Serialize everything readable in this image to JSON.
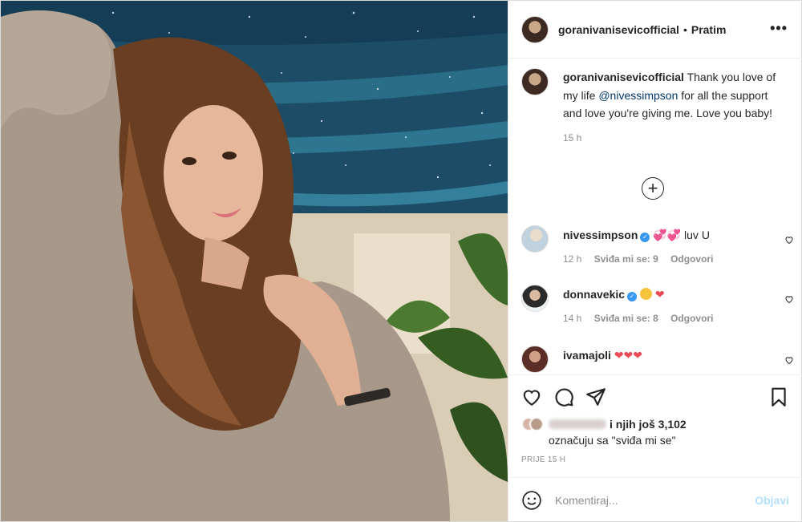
{
  "post": {
    "username": "goranivanisevicofficial",
    "separator": "•",
    "follow_status": "Pratim",
    "more_label": "•••",
    "caption": {
      "username": "goranivanisevicofficial",
      "text_before": " Thank you love of my life ",
      "mention": "@nivessimpson",
      "text_after": " for all the support and love you're giving me. Love you baby!",
      "time": "15 h"
    },
    "load_more_label": "+"
  },
  "comments": [
    {
      "username": "nivessimpson",
      "verified": true,
      "text": " luv U",
      "time": "12 h",
      "likes": "Sviđa mi se: 9",
      "reply": "Odgovori"
    },
    {
      "username": "donnavekic",
      "verified": true,
      "text": "",
      "time": "14 h",
      "likes": "Sviđa mi se: 8",
      "reply": "Odgovori"
    },
    {
      "username": "ivamajoli",
      "verified": false,
      "text": ""
    }
  ],
  "likes": {
    "and_others": "i njih još 3,102",
    "line2": "označuju sa \"sviđa mi se\""
  },
  "posted_ago": "PRIJE 15 H",
  "comment_box": {
    "placeholder": "Komentiraj...",
    "post_label": "Objavi"
  },
  "icons": [
    "heart-icon",
    "comment-icon",
    "share-icon",
    "bookmark-icon",
    "emoji-icon",
    "verified-badge-icon",
    "plus-circle-icon",
    "more-icon"
  ],
  "colors": {
    "link": "#00376b",
    "verified": "#3897f0",
    "post_disabled": "#b2dffc",
    "heart": "#ed4956"
  }
}
